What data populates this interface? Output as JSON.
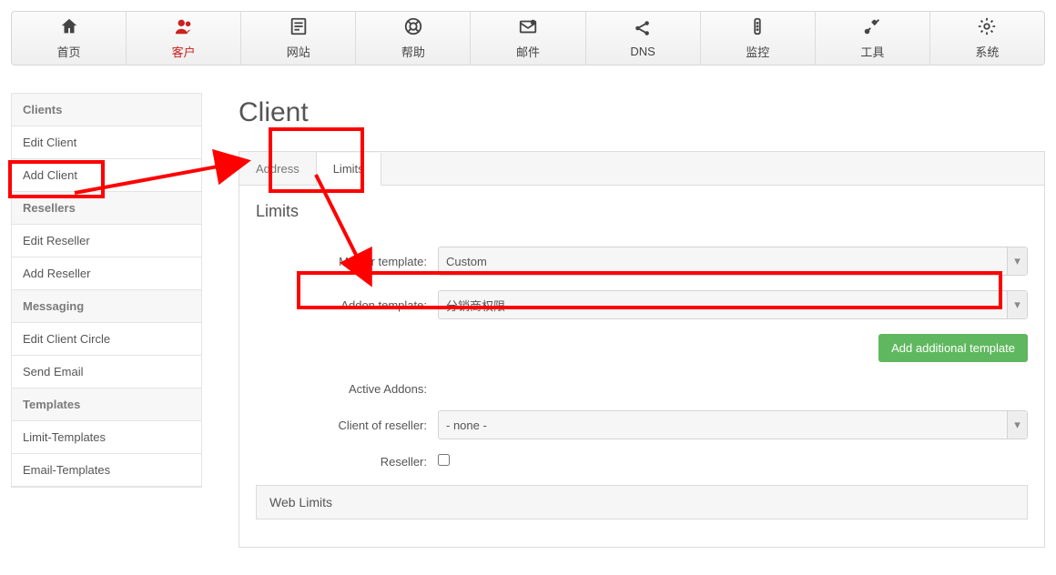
{
  "nav": [
    {
      "label": "首页",
      "icon": "home"
    },
    {
      "label": "客户",
      "icon": "users",
      "active": true
    },
    {
      "label": "网站",
      "icon": "page"
    },
    {
      "label": "帮助",
      "icon": "life-ring"
    },
    {
      "label": "邮件",
      "icon": "envelope"
    },
    {
      "label": "DNS",
      "icon": "share"
    },
    {
      "label": "监控",
      "icon": "traffic"
    },
    {
      "label": "工具",
      "icon": "tools"
    },
    {
      "label": "系统",
      "icon": "gear"
    }
  ],
  "sidebar": [
    {
      "type": "head",
      "label": "Clients"
    },
    {
      "type": "link",
      "label": "Edit Client"
    },
    {
      "type": "link",
      "label": "Add Client",
      "highlight": true
    },
    {
      "type": "head",
      "label": "Resellers"
    },
    {
      "type": "link",
      "label": "Edit Reseller"
    },
    {
      "type": "link",
      "label": "Add Reseller"
    },
    {
      "type": "head",
      "label": "Messaging"
    },
    {
      "type": "link",
      "label": "Edit Client Circle"
    },
    {
      "type": "link",
      "label": "Send Email"
    },
    {
      "type": "head",
      "label": "Templates"
    },
    {
      "type": "link",
      "label": "Limit-Templates"
    },
    {
      "type": "link",
      "label": "Email-Templates"
    }
  ],
  "page": {
    "title": "Client",
    "tabs": [
      {
        "label": "Address"
      },
      {
        "label": "Limits",
        "active": true
      }
    ],
    "section_title": "Limits",
    "fields": {
      "master_template": {
        "label": "Master template:",
        "value": "Custom"
      },
      "addon_template": {
        "label": "Addon template:",
        "value": "分销商权限"
      },
      "active_addons": {
        "label": "Active Addons:"
      },
      "client_reseller": {
        "label": "Client of reseller:",
        "value": "- none -"
      },
      "reseller": {
        "label": "Reseller:",
        "checked": false
      }
    },
    "buttons": {
      "add_additional_template": "Add additional template"
    },
    "sub_panel": "Web Limits"
  }
}
